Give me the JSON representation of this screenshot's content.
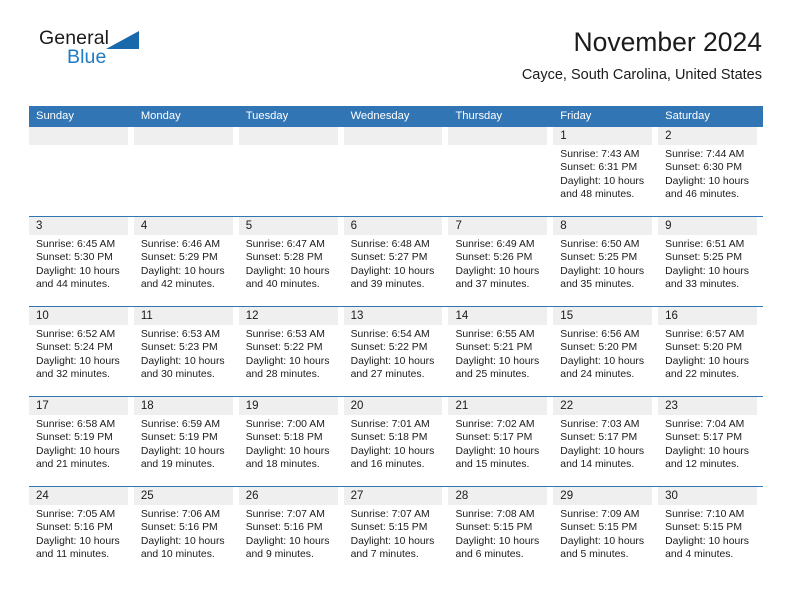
{
  "brand": {
    "name_part1": "General",
    "name_part2": "Blue",
    "triangle_color": "#1769ac",
    "blue_text_color": "#1f7bc4"
  },
  "header": {
    "title": "November 2024",
    "subtitle": "Cayce, South Carolina, United States"
  },
  "theme": {
    "header_blue": "#3275b5",
    "daynum_gray": "#efefef",
    "text_color": "#1b1b1b"
  },
  "weekday_headers": [
    "Sunday",
    "Monday",
    "Tuesday",
    "Wednesday",
    "Thursday",
    "Friday",
    "Saturday"
  ],
  "weeks": [
    [
      {
        "day": "",
        "info": ""
      },
      {
        "day": "",
        "info": ""
      },
      {
        "day": "",
        "info": ""
      },
      {
        "day": "",
        "info": ""
      },
      {
        "day": "",
        "info": ""
      },
      {
        "day": "1",
        "info": "Sunrise: 7:43 AM\nSunset: 6:31 PM\nDaylight: 10 hours\nand 48 minutes."
      },
      {
        "day": "2",
        "info": "Sunrise: 7:44 AM\nSunset: 6:30 PM\nDaylight: 10 hours\nand 46 minutes."
      }
    ],
    [
      {
        "day": "3",
        "info": "Sunrise: 6:45 AM\nSunset: 5:30 PM\nDaylight: 10 hours\nand 44 minutes."
      },
      {
        "day": "4",
        "info": "Sunrise: 6:46 AM\nSunset: 5:29 PM\nDaylight: 10 hours\nand 42 minutes."
      },
      {
        "day": "5",
        "info": "Sunrise: 6:47 AM\nSunset: 5:28 PM\nDaylight: 10 hours\nand 40 minutes."
      },
      {
        "day": "6",
        "info": "Sunrise: 6:48 AM\nSunset: 5:27 PM\nDaylight: 10 hours\nand 39 minutes."
      },
      {
        "day": "7",
        "info": "Sunrise: 6:49 AM\nSunset: 5:26 PM\nDaylight: 10 hours\nand 37 minutes."
      },
      {
        "day": "8",
        "info": "Sunrise: 6:50 AM\nSunset: 5:25 PM\nDaylight: 10 hours\nand 35 minutes."
      },
      {
        "day": "9",
        "info": "Sunrise: 6:51 AM\nSunset: 5:25 PM\nDaylight: 10 hours\nand 33 minutes."
      }
    ],
    [
      {
        "day": "10",
        "info": "Sunrise: 6:52 AM\nSunset: 5:24 PM\nDaylight: 10 hours\nand 32 minutes."
      },
      {
        "day": "11",
        "info": "Sunrise: 6:53 AM\nSunset: 5:23 PM\nDaylight: 10 hours\nand 30 minutes."
      },
      {
        "day": "12",
        "info": "Sunrise: 6:53 AM\nSunset: 5:22 PM\nDaylight: 10 hours\nand 28 minutes."
      },
      {
        "day": "13",
        "info": "Sunrise: 6:54 AM\nSunset: 5:22 PM\nDaylight: 10 hours\nand 27 minutes."
      },
      {
        "day": "14",
        "info": "Sunrise: 6:55 AM\nSunset: 5:21 PM\nDaylight: 10 hours\nand 25 minutes."
      },
      {
        "day": "15",
        "info": "Sunrise: 6:56 AM\nSunset: 5:20 PM\nDaylight: 10 hours\nand 24 minutes."
      },
      {
        "day": "16",
        "info": "Sunrise: 6:57 AM\nSunset: 5:20 PM\nDaylight: 10 hours\nand 22 minutes."
      }
    ],
    [
      {
        "day": "17",
        "info": "Sunrise: 6:58 AM\nSunset: 5:19 PM\nDaylight: 10 hours\nand 21 minutes."
      },
      {
        "day": "18",
        "info": "Sunrise: 6:59 AM\nSunset: 5:19 PM\nDaylight: 10 hours\nand 19 minutes."
      },
      {
        "day": "19",
        "info": "Sunrise: 7:00 AM\nSunset: 5:18 PM\nDaylight: 10 hours\nand 18 minutes."
      },
      {
        "day": "20",
        "info": "Sunrise: 7:01 AM\nSunset: 5:18 PM\nDaylight: 10 hours\nand 16 minutes."
      },
      {
        "day": "21",
        "info": "Sunrise: 7:02 AM\nSunset: 5:17 PM\nDaylight: 10 hours\nand 15 minutes."
      },
      {
        "day": "22",
        "info": "Sunrise: 7:03 AM\nSunset: 5:17 PM\nDaylight: 10 hours\nand 14 minutes."
      },
      {
        "day": "23",
        "info": "Sunrise: 7:04 AM\nSunset: 5:17 PM\nDaylight: 10 hours\nand 12 minutes."
      }
    ],
    [
      {
        "day": "24",
        "info": "Sunrise: 7:05 AM\nSunset: 5:16 PM\nDaylight: 10 hours\nand 11 minutes."
      },
      {
        "day": "25",
        "info": "Sunrise: 7:06 AM\nSunset: 5:16 PM\nDaylight: 10 hours\nand 10 minutes."
      },
      {
        "day": "26",
        "info": "Sunrise: 7:07 AM\nSunset: 5:16 PM\nDaylight: 10 hours\nand 9 minutes."
      },
      {
        "day": "27",
        "info": "Sunrise: 7:07 AM\nSunset: 5:15 PM\nDaylight: 10 hours\nand 7 minutes."
      },
      {
        "day": "28",
        "info": "Sunrise: 7:08 AM\nSunset: 5:15 PM\nDaylight: 10 hours\nand 6 minutes."
      },
      {
        "day": "29",
        "info": "Sunrise: 7:09 AM\nSunset: 5:15 PM\nDaylight: 10 hours\nand 5 minutes."
      },
      {
        "day": "30",
        "info": "Sunrise: 7:10 AM\nSunset: 5:15 PM\nDaylight: 10 hours\nand 4 minutes."
      }
    ]
  ]
}
